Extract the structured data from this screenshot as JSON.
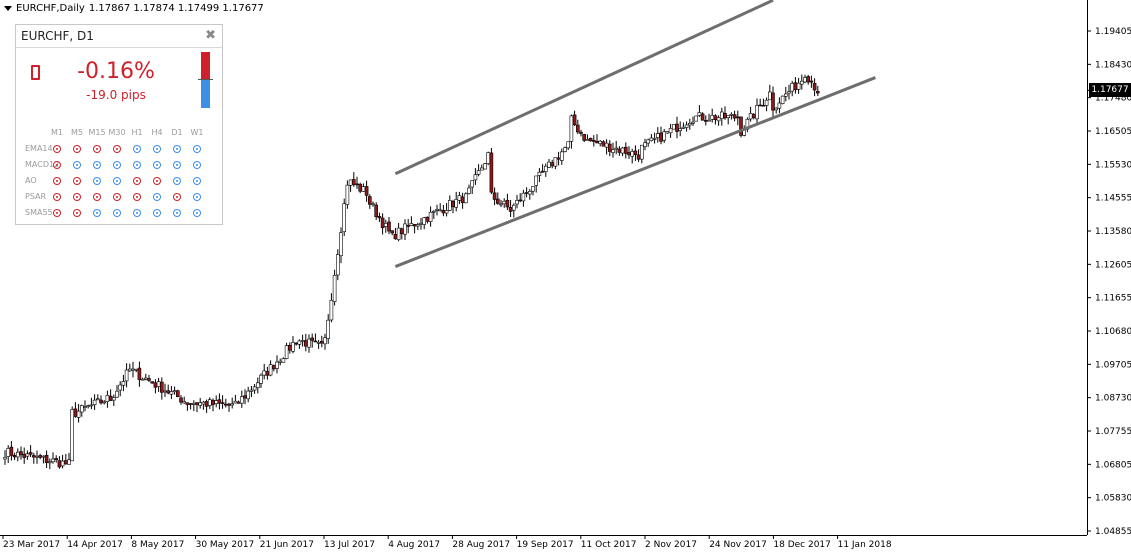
{
  "chart": {
    "symbol_title": "EURCHF,Daily",
    "ohlc": "1.17867 1.17874 1.17499 1.17677",
    "current_price_label": "1.17677",
    "current_price": 1.17677
  },
  "chart_data": {
    "type": "candlestick",
    "price_scale_ticks": [
      "1.19405",
      "1.18430",
      "1.17480",
      "1.16505",
      "1.15530",
      "1.14555",
      "1.13580",
      "1.12605",
      "1.11655",
      "1.10680",
      "1.09705",
      "1.08730",
      "1.07755",
      "1.06805",
      "1.05830",
      "1.04855"
    ],
    "date_labels": [
      "23 Mar 2017",
      "14 Apr 2017",
      "8 May 2017",
      "30 May 2017",
      "21 Jun 2017",
      "13 Jul 2017",
      "4 Aug 2017",
      "28 Aug 2017",
      "19 Sep 2017",
      "11 Oct 2017",
      "2 Nov 2017",
      "24 Nov 2017",
      "18 Dec 2017",
      "11 Jan 2018"
    ],
    "ylim": [
      1.04855,
      1.19405
    ],
    "colors": {
      "bull": "#ffffff",
      "bear": "#8b1a1a",
      "wick": "#000000",
      "channel": "#6e6e6e"
    },
    "channel": {
      "upper": {
        "start_bar": 122,
        "start_price": 1.1525,
        "end_bar": 240,
        "end_price": 1.203
      },
      "lower": {
        "start_bar": 122,
        "start_price": 1.1255,
        "end_bar": 272,
        "end_price": 1.1805
      }
    },
    "segments": [
      {
        "bars": 21,
        "start": 1.0715,
        "end": 1.068
      },
      {
        "bars": 1,
        "start": 1.079,
        "end": 1.083
      },
      {
        "bars": 11,
        "start": 1.083,
        "end": 1.087
      },
      {
        "bars": 7,
        "start": 1.087,
        "end": 1.0955
      },
      {
        "bars": 18,
        "start": 1.095,
        "end": 1.086
      },
      {
        "bars": 14,
        "start": 1.086,
        "end": 1.085
      },
      {
        "bars": 20,
        "start": 1.085,
        "end": 1.104
      },
      {
        "bars": 8,
        "start": 1.104,
        "end": 1.102
      },
      {
        "bars": 8,
        "start": 1.104,
        "end": 1.15
      },
      {
        "bars": 6,
        "start": 1.15,
        "end": 1.147
      },
      {
        "bars": 8,
        "start": 1.144,
        "end": 1.134
      },
      {
        "bars": 22,
        "start": 1.135,
        "end": 1.1455
      },
      {
        "bars": 8,
        "start": 1.1455,
        "end": 1.158
      },
      {
        "bars": 7,
        "start": 1.146,
        "end": 1.142
      },
      {
        "bars": 18,
        "start": 1.143,
        "end": 1.161
      },
      {
        "bars": 6,
        "start": 1.168,
        "end": 1.162
      },
      {
        "bars": 16,
        "start": 1.162,
        "end": 1.158
      },
      {
        "bars": 17,
        "start": 1.16,
        "end": 1.169
      },
      {
        "bars": 14,
        "start": 1.169,
        "end": 1.169
      },
      {
        "bars": 10,
        "start": 1.165,
        "end": 1.176
      },
      {
        "bars": 10,
        "start": 1.172,
        "end": 1.18
      },
      {
        "bars": 5,
        "start": 1.182,
        "end": 1.1768
      }
    ]
  },
  "panel": {
    "title": "EURCHF, D1",
    "close_glyph": "✖",
    "change_pct": "-0.16%",
    "change_pips": "-19.0 pips",
    "strength": {
      "up": 0.5,
      "down": 0.5
    },
    "timeframes": [
      "M1",
      "M5",
      "M15",
      "M30",
      "H1",
      "H4",
      "D1",
      "W1"
    ],
    "indicators": [
      {
        "name": "EMA14",
        "signals": [
          "red",
          "red",
          "red",
          "red",
          "blue",
          "blue",
          "blue",
          "blue"
        ]
      },
      {
        "name": "MACD12",
        "signals": [
          "red",
          "blue",
          "blue",
          "blue",
          "blue",
          "blue",
          "blue",
          "blue"
        ]
      },
      {
        "name": "AO",
        "signals": [
          "red",
          "red",
          "blue",
          "blue",
          "red",
          "red",
          "blue",
          "blue"
        ]
      },
      {
        "name": "PSAR",
        "signals": [
          "red",
          "red",
          "red",
          "red",
          "red",
          "blue",
          "red",
          "blue"
        ]
      },
      {
        "name": "SMA55",
        "signals": [
          "red",
          "red",
          "blue",
          "blue",
          "blue",
          "blue",
          "blue",
          "blue"
        ]
      }
    ],
    "icons": {
      "ticker": "trend-frame-icon",
      "close": "close-icon"
    }
  }
}
